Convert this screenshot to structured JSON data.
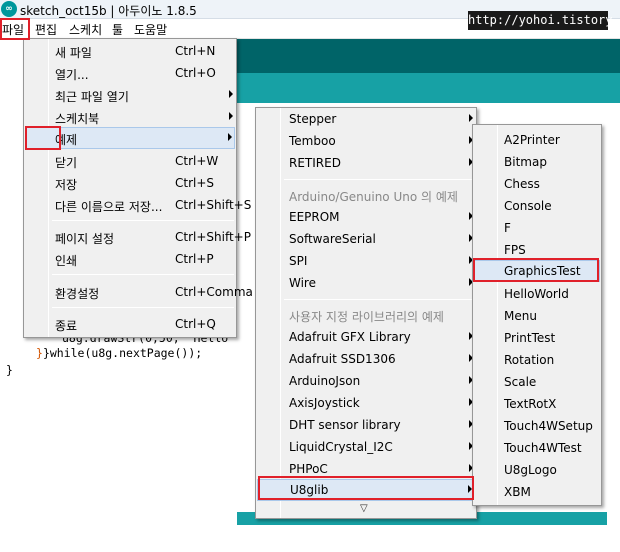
{
  "window": {
    "title": "sketch_oct15b | 아두이노 1.8.5",
    "watermark": "http://yohoi.tistory.com"
  },
  "menubar": [
    "파일",
    "편집",
    "스케치",
    "툴",
    "도움말"
  ],
  "editor": {
    "lines": [
      "u8g.drawStr(0,50, \"Hello",
      "}while(u8g.nextPage());",
      "}"
    ]
  },
  "file_menu": {
    "items": [
      {
        "label": "새 파일",
        "shortcut": "Ctrl+N"
      },
      {
        "label": "열기...",
        "shortcut": "Ctrl+O"
      },
      {
        "label": "최근 파일 열기",
        "shortcut": ""
      },
      {
        "label": "스케치북",
        "shortcut": ""
      },
      {
        "label": "예제",
        "shortcut": ""
      },
      {
        "label": "닫기",
        "shortcut": "Ctrl+W"
      },
      {
        "label": "저장",
        "shortcut": "Ctrl+S"
      },
      {
        "label": "다른 이름으로 저장...",
        "shortcut": "Ctrl+Shift+S"
      },
      {
        "label": "페이지 설정",
        "shortcut": "Ctrl+Shift+P"
      },
      {
        "label": "인쇄",
        "shortcut": "Ctrl+P"
      },
      {
        "label": "환경설정",
        "shortcut": "Ctrl+Comma"
      },
      {
        "label": "종료",
        "shortcut": "Ctrl+Q"
      }
    ]
  },
  "examples_menu": {
    "items": [
      "Stepper",
      "Temboo",
      "RETIRED"
    ],
    "section_board": "Arduino/Genuino Uno 의 예제",
    "board_items": [
      "EEPROM",
      "SoftwareSerial",
      "SPI",
      "Wire"
    ],
    "section_custom": "사용자 지정 라이브러리의 예제",
    "custom_items": [
      "Adafruit GFX Library",
      "Adafruit SSD1306",
      "ArduinoJson",
      "AxisJoystick",
      "DHT sensor library",
      "LiquidCrystal_I2C",
      "PHPoC",
      "U8glib"
    ],
    "more_arrow": "▽"
  },
  "u8glib_menu": {
    "items": [
      "A2Printer",
      "Bitmap",
      "Chess",
      "Console",
      "F",
      "FPS",
      "GraphicsTest",
      "HelloWorld",
      "Menu",
      "PrintTest",
      "Rotation",
      "Scale",
      "TextRotX",
      "Touch4WSetup",
      "Touch4WTest",
      "U8gLogo",
      "XBM"
    ]
  },
  "colors": {
    "highlight_box": "#e0202a",
    "arduino_teal_dark": "#006468",
    "arduino_teal": "#17a1a5"
  }
}
